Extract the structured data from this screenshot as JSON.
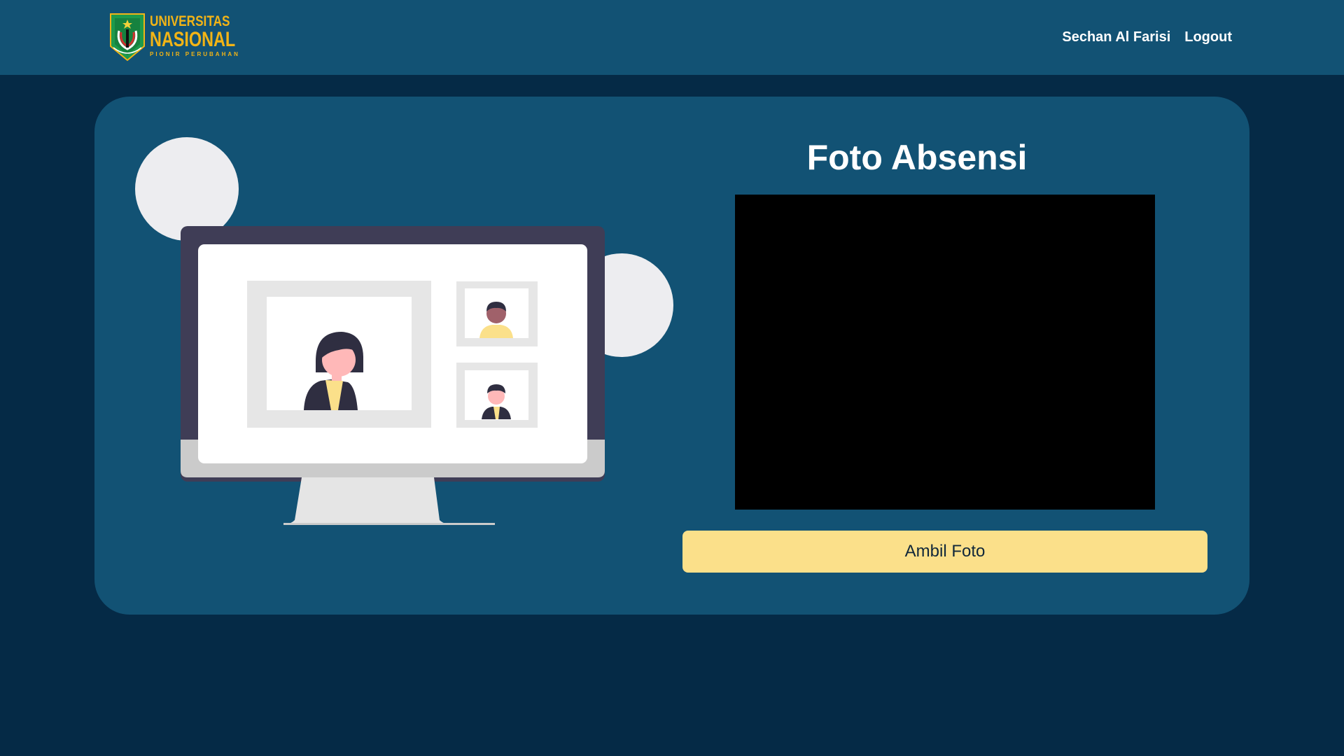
{
  "header": {
    "logo": {
      "line1": "UNIVERSITAS",
      "line2": "NASIONAL",
      "line3": "PIONIR PERUBAHAN"
    },
    "user_name": "Sechan Al Farisi",
    "logout_label": "Logout"
  },
  "main": {
    "title": "Foto Absensi",
    "capture_button_label": "Ambil Foto",
    "illustration_icon": "video-conference-illustration"
  },
  "colors": {
    "page_background": "#052a46",
    "navbar_background": "#125274",
    "card_background": "#125274",
    "logo_gold": "#f2b416",
    "button_yellow": "#fbe08a",
    "camera_black": "#000000"
  }
}
